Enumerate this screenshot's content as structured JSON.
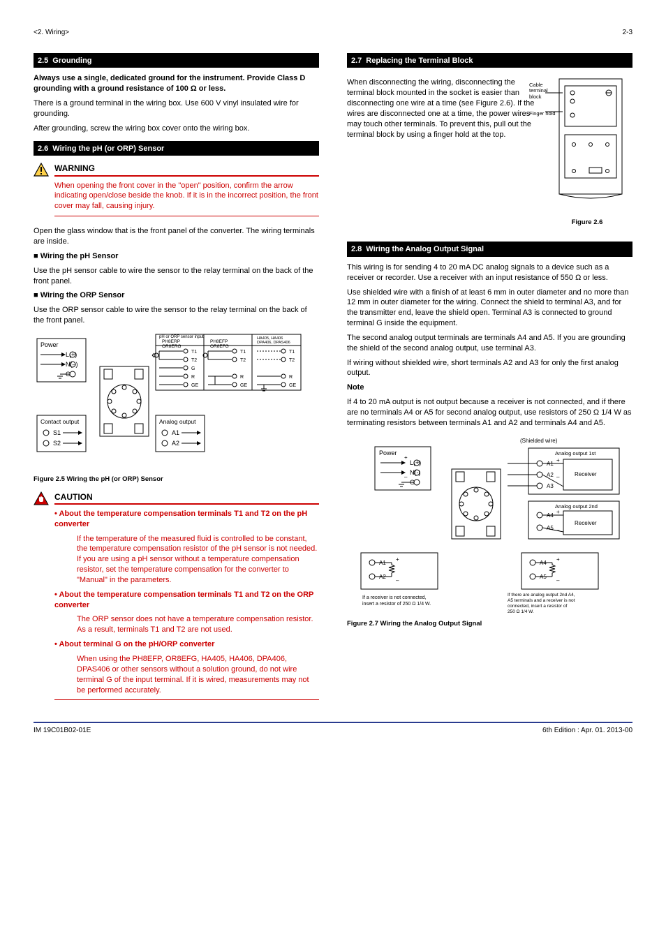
{
  "header": {
    "left": "<2. Wiring>",
    "right": "2-3"
  },
  "leftCol": {
    "s25": {
      "num": "2.5",
      "title": "Grounding",
      "p1_bold": "Always use a single, dedicated ground for the instrument. Provide Class D grounding with a ground resistance of 100 Ω or less.",
      "p2": "There is a ground terminal in the wiring box. Use 600 V vinyl insulated wire for grounding.",
      "p3": "After grounding, screw the wiring box cover onto the wiring box."
    },
    "s26": {
      "num": "2.6",
      "title": "Wiring the pH (or ORP) Sensor",
      "warning_label": "WARNING",
      "warning_body": "When opening the front cover in the \"open\" position, confirm the arrow indicating open/close beside the knob.  If it is in the incorrect position, the front cover may fall, causing injury.",
      "open_glass": "Open the glass window that is the front panel of the converter. The wiring terminals are inside.",
      "sub_pH": "■ Wiring the pH Sensor",
      "sub_pH_body": "Use the pH sensor cable to wire the sensor to the relay terminal on the back of the front panel.",
      "sub_orp": "■ Wiring the ORP Sensor",
      "sub_orp_body": "Use the ORP sensor cable to wire the sensor to the relay terminal on the back of the front panel.",
      "fig25": "Figure 2.5  Wiring the pH (or ORP) Sensor",
      "caution_label": "CAUTION",
      "caution_b1_head": "• About the temperature compensation terminals T1 and T2 on the pH converter",
      "caution_b1_body": "If the temperature of the measured fluid is controlled to be constant, the temperature compensation resistor of the pH sensor is not needed. If you are using a pH sensor without a temperature compensation resistor, set the temperature compensation for the converter to \"Manual\" in the parameters.",
      "caution_b2_head": "• About the temperature compensation terminals T1 and T2 on the ORP converter",
      "caution_b2_body": "The ORP sensor does not have a temperature compensation resistor. As a result, terminals T1 and T2 are not used.",
      "caution_b3_head": "• About terminal G on the pH/ORP converter",
      "caution_b3_body": "When using the PH8EFP, OR8EFG, HA405, HA406, DPA406, DPAS406 or other sensors without a solution ground, do not wire terminal G of the input terminal. If it is wired, measurements may not be performed accurately."
    },
    "diag25": {
      "power_title": "Power",
      "power_l": "L(+)",
      "power_n": "N(–)",
      "power_g": "G",
      "contact_out_title": "Contact output",
      "contact_s1": "S1",
      "contact_s2": "S2",
      "analog_out_title": "Analog output",
      "analog_a1": "A1",
      "analog_a2": "A2",
      "sensor_title": "pH or ORP sensor input",
      "ph8erp_h": "PH8ERP\nOR8ERG",
      "ph8efp_h": "PH8EFP\nOR8EFG",
      "ha405_h": "HA405, HA406\nDPA406, DPAS406",
      "T1": "T1",
      "T2": "T2",
      "G": "G",
      "R": "R",
      "GE": "GE"
    }
  },
  "rightCol": {
    "s27": {
      "num": "2.7",
      "title": "Replacing the Terminal Block",
      "p1": "When disconnecting the wiring, disconnecting the terminal block mounted in the socket is easier than disconnecting one wire at a time (see Figure 2.6). If the wires are disconnected one at a time, the power wires may touch other terminals. To prevent this, pull out the terminal block by using a finger hold at the top.",
      "fig26": "Figure 2.6",
      "ann_block": "Cable terminal block",
      "ann_hold": "Finger hold"
    },
    "s28": {
      "num": "2.8",
      "title": "Wiring the Analog Output Signal",
      "p1": "This wiring is for sending 4 to 20 mA DC analog signals to a device such as a receiver or recorder. Use a receiver with an input resistance of 550 Ω or less.",
      "p2": "Use shielded wire with a finish of at least 6 mm in outer diameter and no more than 12 mm in outer diameter for the wiring. Connect the shield to terminal A3, and for the transmitter end, leave the shield open. Terminal A3 is connected to ground terminal G inside the equipment.",
      "p3": "The second analog output terminals are terminals A4 and A5. If you are grounding the shield of the second analog output, use terminal A3.",
      "p4": "If wiring without shielded wire, short terminals A2 and A3 for only the first analog output.",
      "note_head": "Note",
      "note_body": "If 4 to 20 mA output is not output because a receiver is not connected, and if there are no terminals A4 or A5 for second analog output, use resistors of 250 Ω 1/4 W as terminating resistors between terminals A1 and A2 and terminals A4 and A5.",
      "fig27": "Figure 2.7  Wiring the Analog Output Signal"
    },
    "diag27": {
      "power_title": "Power",
      "L": "L(+)",
      "N": "N(-)",
      "G": "G",
      "shielded": "(Shielded wire)",
      "receiver_1st": "Analog output 1st\nReceiver",
      "A1": "A1",
      "A2": "A2",
      "A3": "A3",
      "receiver_2nd": "Analog output 2nd\nReceiver",
      "A4": "A4",
      "A5": "A5",
      "no_receiver_1st_note": "If a receiver is not connected,\ninsert a resistor of 250 Ω 1/4 W.",
      "second_note": "If there are analog output 2nd A4,\nA5 terminals and a receiver is not\nconnected, insert a resistor of\n250 Ω 1/4 W.",
      "A1b": "A1",
      "A2b": "A2",
      "A4b": "A4",
      "A5b": "A5"
    }
  },
  "footer": {
    "left": "IM 19C01B02-01E",
    "right": "6th Edition : Apr. 01. 2013-00"
  }
}
